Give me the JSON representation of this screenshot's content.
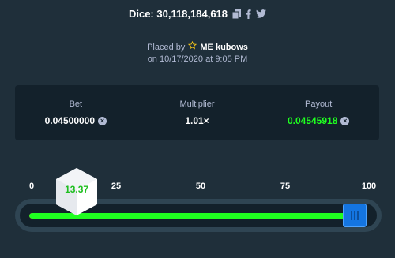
{
  "header": {
    "title": "Dice: 30,118,184,618",
    "icons": [
      "copy-icon",
      "facebook-icon",
      "twitter-icon"
    ]
  },
  "placed": {
    "prefix": "Placed by",
    "user_icon": "star-icon",
    "username": "ME kubows",
    "date_line": "on 10/17/2020 at 9:05 PM"
  },
  "stats": {
    "bet": {
      "label": "Bet",
      "value": "0.04500000"
    },
    "multiplier": {
      "label": "Multiplier",
      "value": "1.01×"
    },
    "payout": {
      "label": "Payout",
      "value": "0.04545918"
    }
  },
  "slider": {
    "ticks": [
      "0",
      "25",
      "50",
      "75",
      "100"
    ],
    "roll_value": "13.37",
    "win_fraction": 0.98,
    "colors": {
      "win": "#1fff20",
      "lose": "#ff3b3b",
      "handle": "#1475e1"
    }
  }
}
